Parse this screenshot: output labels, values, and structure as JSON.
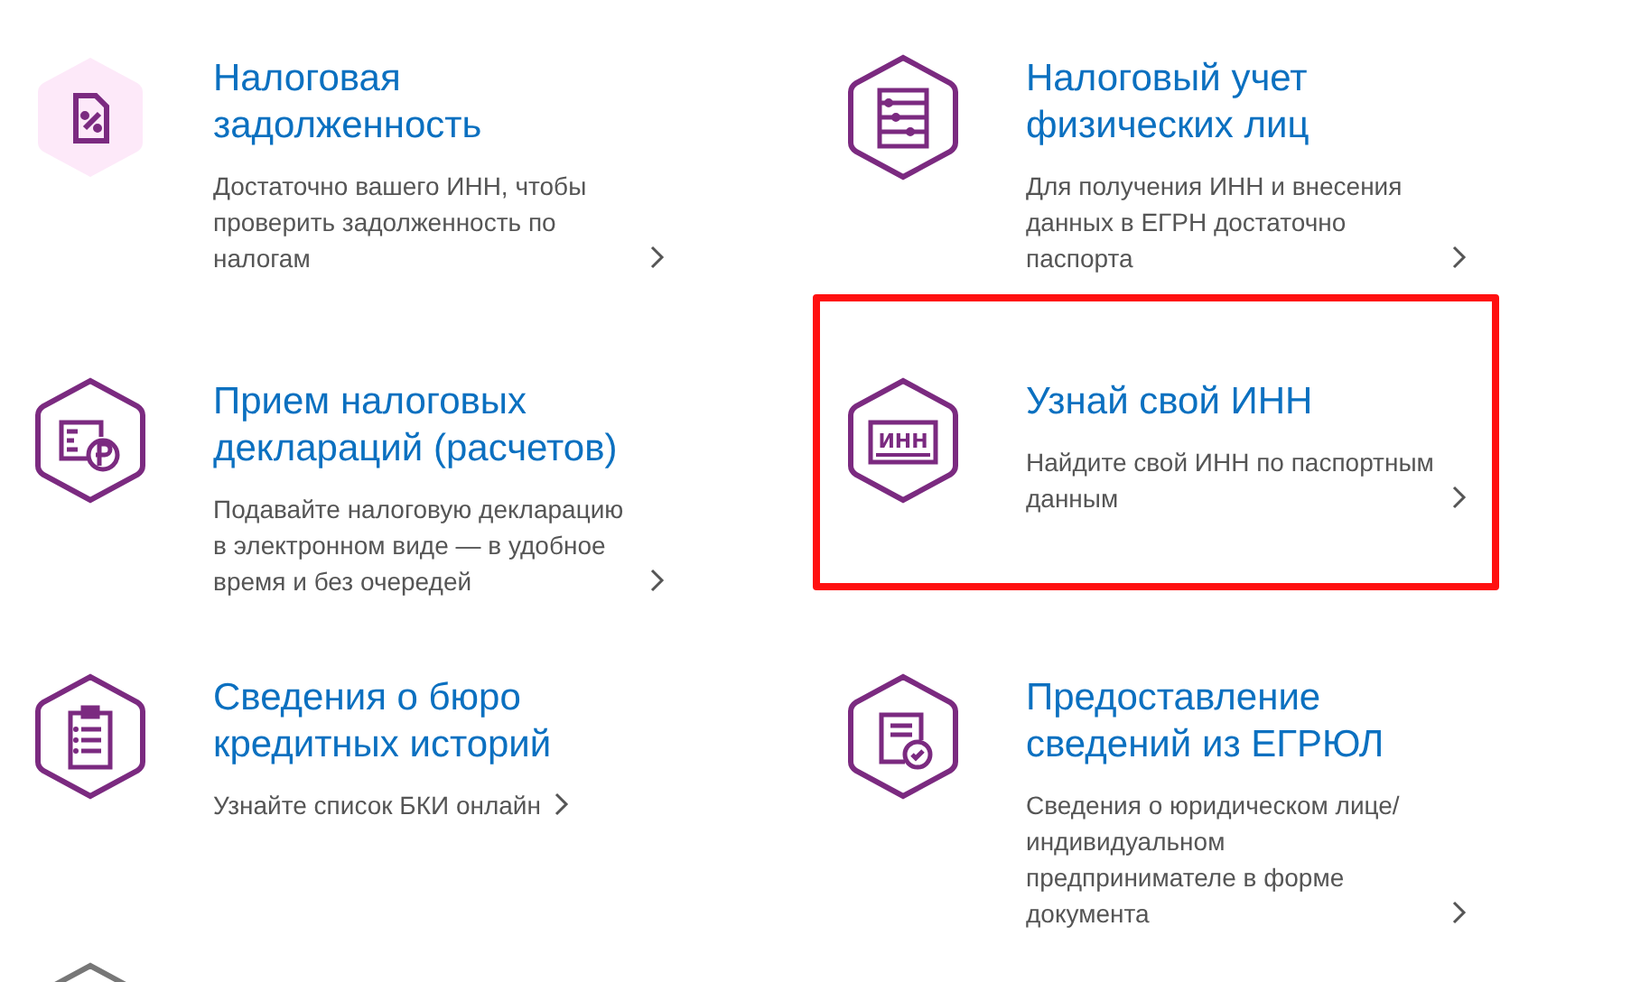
{
  "services": [
    {
      "kind": "percent-document",
      "title": "Налоговая задолженность",
      "description": "Достаточно вашего ИНН, чтобы проверить задолженность по налогам",
      "highlighted": false
    },
    {
      "kind": "abacus",
      "title": "Налоговый учет физических лиц",
      "description": "Для получения ИНН и внесения данных в ЕГРН достаточно паспорта",
      "highlighted": false
    },
    {
      "kind": "ruble-document",
      "title": "Прием налоговых деклараций (расчетов)",
      "description": "Подавайте налоговую декларацию в электронном виде — в удобное время и без очередей",
      "highlighted": false
    },
    {
      "kind": "inn-card",
      "icon_text": "ИНН",
      "title": "Узнай свой ИНН",
      "description": "Найдите свой ИНН по паспортным данным",
      "highlighted": true
    },
    {
      "kind": "clipboard-list",
      "title": "Сведения о бюро кредитных историй",
      "description": "Узнайте список БКИ онлайн",
      "highlighted": false
    },
    {
      "kind": "document-check",
      "title": "Предоставление сведений из ЕГРЮЛ",
      "description": "Сведения о юридическом лице/ индивидуальном предпринимателе в форме документа",
      "highlighted": false
    },
    {
      "kind": "cut-off",
      "highlighted": false
    }
  ]
}
